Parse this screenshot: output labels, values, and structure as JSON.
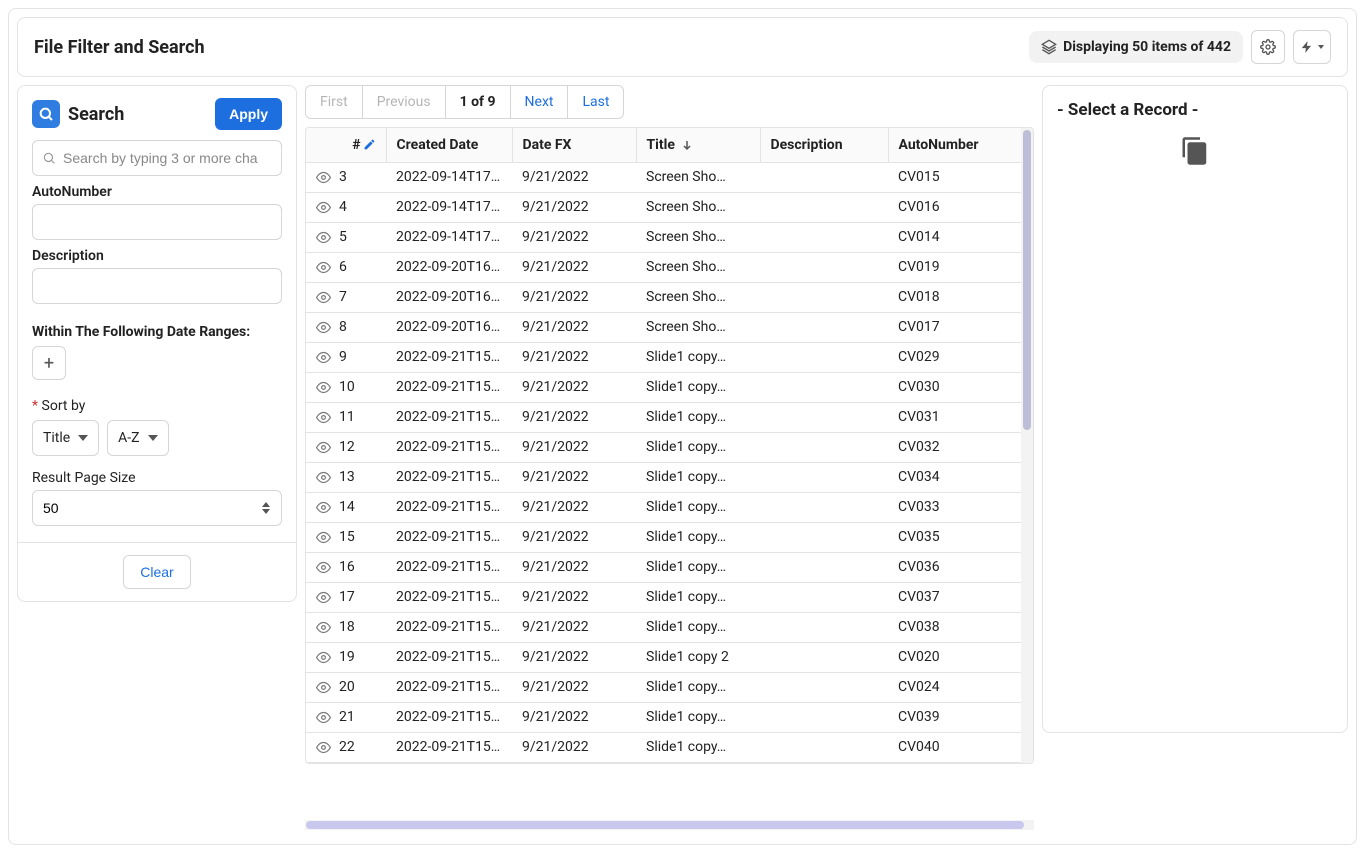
{
  "header": {
    "title": "File Filter and Search",
    "count_text": "Displaying 50 items of 442"
  },
  "sidebar": {
    "search_heading": "Search",
    "apply_label": "Apply",
    "search_placeholder": "Search by typing 3 or more cha",
    "autonumber_label": "AutoNumber",
    "autonumber_value": "",
    "description_label": "Description",
    "description_value": "",
    "date_ranges_label": "Within The Following Date Ranges:",
    "sort_by_label": "Sort by",
    "sort_field": "Title",
    "sort_dir": "A-Z",
    "page_size_label": "Result Page Size",
    "page_size_value": "50",
    "clear_label": "Clear"
  },
  "pagination": {
    "first": "First",
    "previous": "Previous",
    "current": "1 of 9",
    "next": "Next",
    "last": "Last"
  },
  "columns": {
    "index": "#",
    "created": "Created Date",
    "datefx": "Date FX",
    "title": "Title",
    "description": "Description",
    "autonumber": "AutoNumber"
  },
  "rows": [
    {
      "n": "3",
      "created": "2022-09-14T17…",
      "datefx": "9/21/2022",
      "title": "Screen Sho…",
      "desc": "",
      "auto": "CV015"
    },
    {
      "n": "4",
      "created": "2022-09-14T17…",
      "datefx": "9/21/2022",
      "title": "Screen Sho…",
      "desc": "",
      "auto": "CV016"
    },
    {
      "n": "5",
      "created": "2022-09-14T17…",
      "datefx": "9/21/2022",
      "title": "Screen Sho…",
      "desc": "",
      "auto": "CV014"
    },
    {
      "n": "6",
      "created": "2022-09-20T16…",
      "datefx": "9/21/2022",
      "title": "Screen Sho…",
      "desc": "",
      "auto": "CV019"
    },
    {
      "n": "7",
      "created": "2022-09-20T16…",
      "datefx": "9/21/2022",
      "title": "Screen Sho…",
      "desc": "",
      "auto": "CV018"
    },
    {
      "n": "8",
      "created": "2022-09-20T16…",
      "datefx": "9/21/2022",
      "title": "Screen Sho…",
      "desc": "",
      "auto": "CV017"
    },
    {
      "n": "9",
      "created": "2022-09-21T15…",
      "datefx": "9/21/2022",
      "title": "Slide1 copy…",
      "desc": "",
      "auto": "CV029"
    },
    {
      "n": "10",
      "created": "2022-09-21T15…",
      "datefx": "9/21/2022",
      "title": "Slide1 copy…",
      "desc": "",
      "auto": "CV030"
    },
    {
      "n": "11",
      "created": "2022-09-21T15…",
      "datefx": "9/21/2022",
      "title": "Slide1 copy…",
      "desc": "",
      "auto": "CV031"
    },
    {
      "n": "12",
      "created": "2022-09-21T15…",
      "datefx": "9/21/2022",
      "title": "Slide1 copy…",
      "desc": "",
      "auto": "CV032"
    },
    {
      "n": "13",
      "created": "2022-09-21T15…",
      "datefx": "9/21/2022",
      "title": "Slide1 copy…",
      "desc": "",
      "auto": "CV034"
    },
    {
      "n": "14",
      "created": "2022-09-21T15…",
      "datefx": "9/21/2022",
      "title": "Slide1 copy…",
      "desc": "",
      "auto": "CV033"
    },
    {
      "n": "15",
      "created": "2022-09-21T15…",
      "datefx": "9/21/2022",
      "title": "Slide1 copy…",
      "desc": "",
      "auto": "CV035"
    },
    {
      "n": "16",
      "created": "2022-09-21T15…",
      "datefx": "9/21/2022",
      "title": "Slide1 copy…",
      "desc": "",
      "auto": "CV036"
    },
    {
      "n": "17",
      "created": "2022-09-21T15…",
      "datefx": "9/21/2022",
      "title": "Slide1 copy…",
      "desc": "",
      "auto": "CV037"
    },
    {
      "n": "18",
      "created": "2022-09-21T15…",
      "datefx": "9/21/2022",
      "title": "Slide1 copy…",
      "desc": "",
      "auto": "CV038"
    },
    {
      "n": "19",
      "created": "2022-09-21T15…",
      "datefx": "9/21/2022",
      "title": "Slide1 copy 2",
      "desc": "",
      "auto": "CV020"
    },
    {
      "n": "20",
      "created": "2022-09-21T15…",
      "datefx": "9/21/2022",
      "title": "Slide1 copy…",
      "desc": "",
      "auto": "CV024"
    },
    {
      "n": "21",
      "created": "2022-09-21T15…",
      "datefx": "9/21/2022",
      "title": "Slide1 copy…",
      "desc": "",
      "auto": "CV039"
    },
    {
      "n": "22",
      "created": "2022-09-21T15…",
      "datefx": "9/21/2022",
      "title": "Slide1 copy…",
      "desc": "",
      "auto": "CV040"
    }
  ],
  "detail": {
    "title": "- Select a Record -"
  }
}
